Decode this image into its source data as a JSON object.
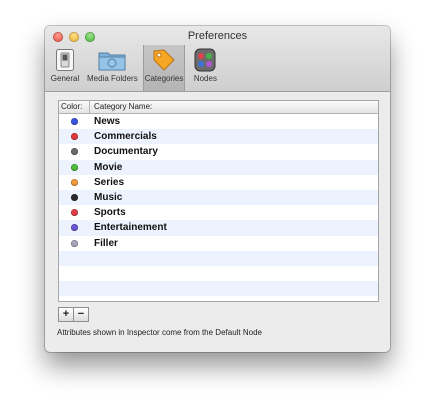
{
  "window": {
    "title": "Preferences"
  },
  "toolbar": {
    "items": [
      {
        "label": "General",
        "icon": "light-switch-icon",
        "selected": false
      },
      {
        "label": "Media Folders",
        "icon": "folder-icon",
        "selected": false
      },
      {
        "label": "Categories",
        "icon": "tag-icon",
        "selected": true
      },
      {
        "label": "Nodes",
        "icon": "nodes-icon",
        "selected": false
      }
    ]
  },
  "table": {
    "headers": {
      "color": "Color:",
      "name": "Category  Name:"
    },
    "rows": [
      {
        "name": "News",
        "color": "#3b55e0"
      },
      {
        "name": "Commercials",
        "color": "#e23a3a"
      },
      {
        "name": "Documentary",
        "color": "#6c6c6c"
      },
      {
        "name": "Movie",
        "color": "#4fbd3c"
      },
      {
        "name": "Series",
        "color": "#f09a3a"
      },
      {
        "name": "Music",
        "color": "#2a2a2a"
      },
      {
        "name": "Sports",
        "color": "#e23f4a"
      },
      {
        "name": "Entertainement",
        "color": "#6b58d6"
      },
      {
        "name": "Filler",
        "color": "#a7a7b9"
      }
    ]
  },
  "buttons": {
    "add_label": "+",
    "remove_label": "−"
  },
  "footer": {
    "text": "Attributes shown in Inspector come from the Default Node"
  }
}
